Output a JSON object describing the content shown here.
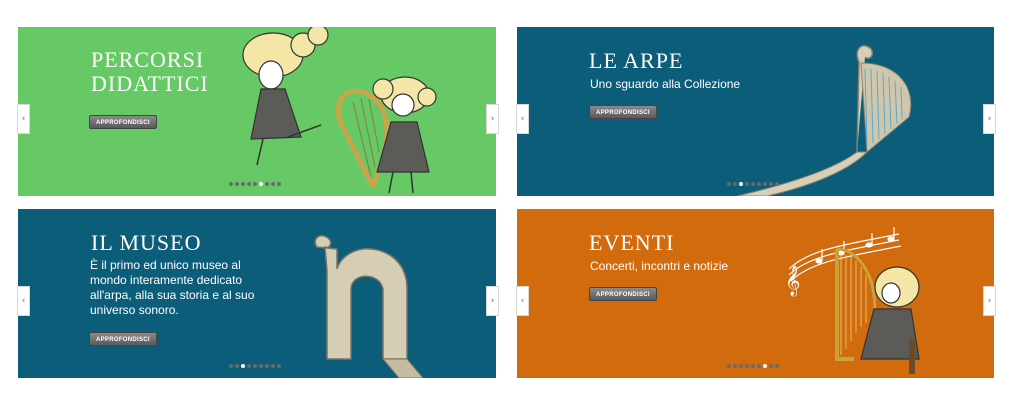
{
  "slider_percorsi": {
    "title": "PERCORSI\nDIDATTICI",
    "button": "APPROFONDISCI",
    "prev_arrow": "‹",
    "next_arrow": "›",
    "dots_total": 9,
    "active_dot": 6,
    "bg": "#66c966"
  },
  "slider_arpe": {
    "title": "LE ARPE",
    "subtitle": "Uno sguardo alla Collezione",
    "button": "APPROFONDISCI",
    "prev_arrow": "‹",
    "next_arrow": "›",
    "dots_total": 9,
    "active_dot": 3,
    "bg": "#0b5d7a"
  },
  "slider_museo": {
    "title": "IL MUSEO",
    "description": "È il primo ed unico museo al mondo interamente dedicato all'arpa, alla sua storia e al suo universo sonoro.",
    "button": "APPROFONDISCI",
    "prev_arrow": "‹",
    "next_arrow": "›",
    "dots_total": 9,
    "active_dot": 3,
    "bg": "#0b5d7a"
  },
  "slider_eventi": {
    "title": "EVENTI",
    "subtitle": "Concerti, incontri e notizie",
    "button": "APPROFONDISCI",
    "prev_arrow": "‹",
    "next_arrow": "›",
    "dots_total": 9,
    "active_dot": 7,
    "bg": "#d26a0e"
  },
  "icons": [
    "chevron-left-icon",
    "chevron-right-icon",
    "harp-illustration",
    "girls-with-harp-illustration",
    "harpist-illustration"
  ]
}
